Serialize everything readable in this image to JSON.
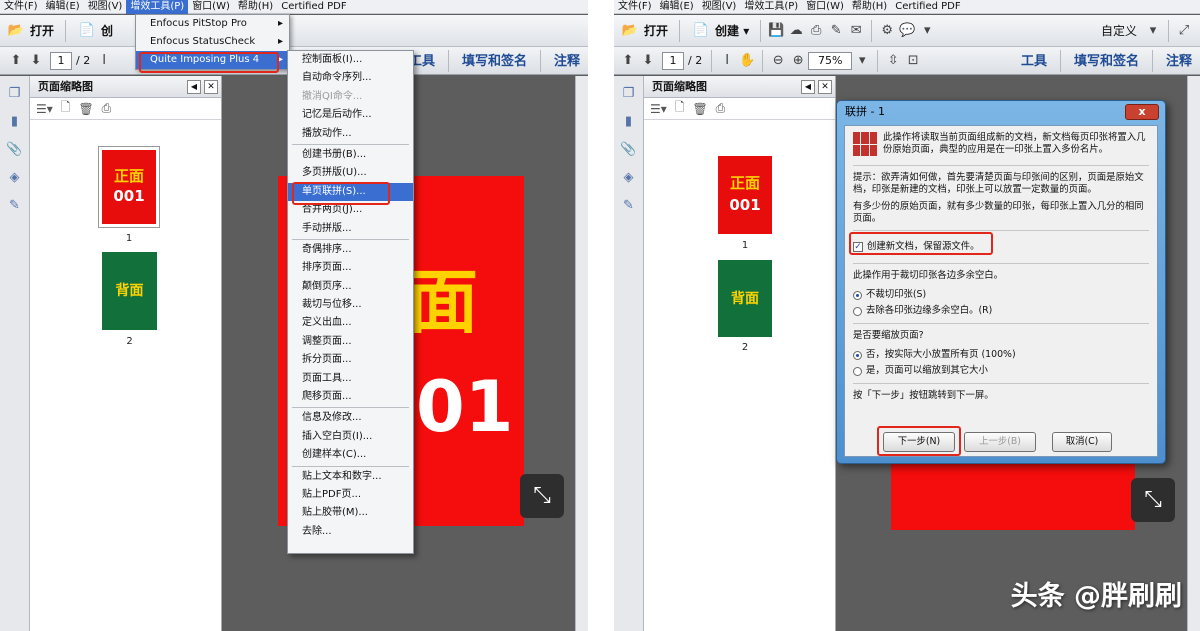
{
  "left": {
    "menubar": [
      "文件(F)",
      "编辑(E)",
      "视图(V)",
      "增效工具(P)",
      "窗口(W)",
      "帮助(H)",
      "Certified PDF"
    ],
    "toolbar": {
      "open": "打开",
      "create": "创"
    },
    "nav": {
      "page": "1",
      "total": "/ 2"
    },
    "links": [
      "工具",
      "填写和签名",
      "注释"
    ],
    "thumbs_title": "页面缩略图",
    "thumbs": [
      {
        "label": "正面",
        "code": "001",
        "num": "1",
        "color": "#e80d0d"
      },
      {
        "label": "背面",
        "code": "",
        "num": "2",
        "color": "#12713a"
      }
    ],
    "page_text": {
      "face": "面",
      "num": "01"
    },
    "plugin_menu": [
      {
        "label": "Enfocus PitStop Pro",
        "sub": true
      },
      {
        "label": "Enfocus StatusCheck",
        "sub": true
      },
      {
        "label": "Quite Imposing Plus 4",
        "sub": true,
        "highlight": true
      }
    ],
    "submenu": [
      {
        "label": "控制面板(I)..."
      },
      {
        "label": "自动命令序列..."
      },
      {
        "label": "撤消QI命令...",
        "disabled": true
      },
      {
        "label": "记忆是后动作..."
      },
      {
        "label": "播放动作..."
      },
      {
        "divider": true
      },
      {
        "label": "创建书册(B)..."
      },
      {
        "label": "多页拼版(U)..."
      },
      {
        "label": "单页联拼(S)...",
        "highlight": true
      },
      {
        "label": "合并两页(J)..."
      },
      {
        "label": "手动拼版..."
      },
      {
        "divider": true
      },
      {
        "label": "奇偶排序..."
      },
      {
        "label": "排序页面..."
      },
      {
        "label": "颠倒页序..."
      },
      {
        "label": "裁切与位移..."
      },
      {
        "label": "定义出血..."
      },
      {
        "label": "调整页面..."
      },
      {
        "label": "拆分页面..."
      },
      {
        "label": "页面工具..."
      },
      {
        "label": "爬移页面..."
      },
      {
        "divider": true
      },
      {
        "label": "信息及修改..."
      },
      {
        "label": "插入空白页(I)..."
      },
      {
        "label": "创建样本(C)..."
      },
      {
        "divider": true
      },
      {
        "label": "贴上文本和数字..."
      },
      {
        "label": "贴上PDF页..."
      },
      {
        "label": "贴上胶带(M)..."
      },
      {
        "label": "去除..."
      }
    ]
  },
  "right": {
    "menubar": [
      "文件(F)",
      "编辑(E)",
      "视图(V)",
      "增效工具(P)",
      "窗口(W)",
      "帮助(H)",
      "Certified PDF"
    ],
    "toolbar": {
      "open": "打开",
      "create": "创建 ▾",
      "customize": "自定义"
    },
    "nav": {
      "page": "1",
      "total": "/ 2",
      "zoom": "75%"
    },
    "links": [
      "工具",
      "填写和签名",
      "注释"
    ],
    "thumbs_title": "页面缩略图",
    "thumbs": [
      {
        "label": "正面",
        "code": "001",
        "num": "1",
        "color": "#e80d0d"
      },
      {
        "label": "背面",
        "code": "",
        "num": "2",
        "color": "#12713a"
      }
    ],
    "dialog": {
      "title": "联拼 - 1",
      "close": "x",
      "intro": "此操作将读取当前页面组成新的文档，新文档每页印张将置入几份原始页面，典型的应用是在一印张上置入多份名片。",
      "tip": "提示：欲弄清如何做，首先要清楚页面与印张间的区别，页面是原始文档，印张是新建的文档，印张上可以放置一定数量的页面。",
      "desc": "有多少份的原始页面，就有多少数量的印张，每印张上置入几分的相同页面。",
      "checkbox": "创建新文档，保留源文件。",
      "trim_question": "此操作用于裁切印张各边多余空白。",
      "trim_options": [
        "不裁切印张(S)",
        "去除各印张边缘多余空白。(R)"
      ],
      "scale_question": "是否要缩放页面?",
      "scale_options": [
        "否，按实际大小放置所有页 (100%)",
        "是，页面可以缩放到其它大小"
      ],
      "next_hint": "按「下一步」按钮跳转到下一屏。",
      "buttons": {
        "next": "下一步(N)",
        "prev": "上一步(B)",
        "cancel": "取消(C)"
      }
    },
    "watermark": "头条 @胖刷刷"
  },
  "colors": {
    "accent": "#3a6fd1",
    "annotation": "#e3261c",
    "page_red": "#f50c0c",
    "page_yellow": "#ffd200"
  }
}
